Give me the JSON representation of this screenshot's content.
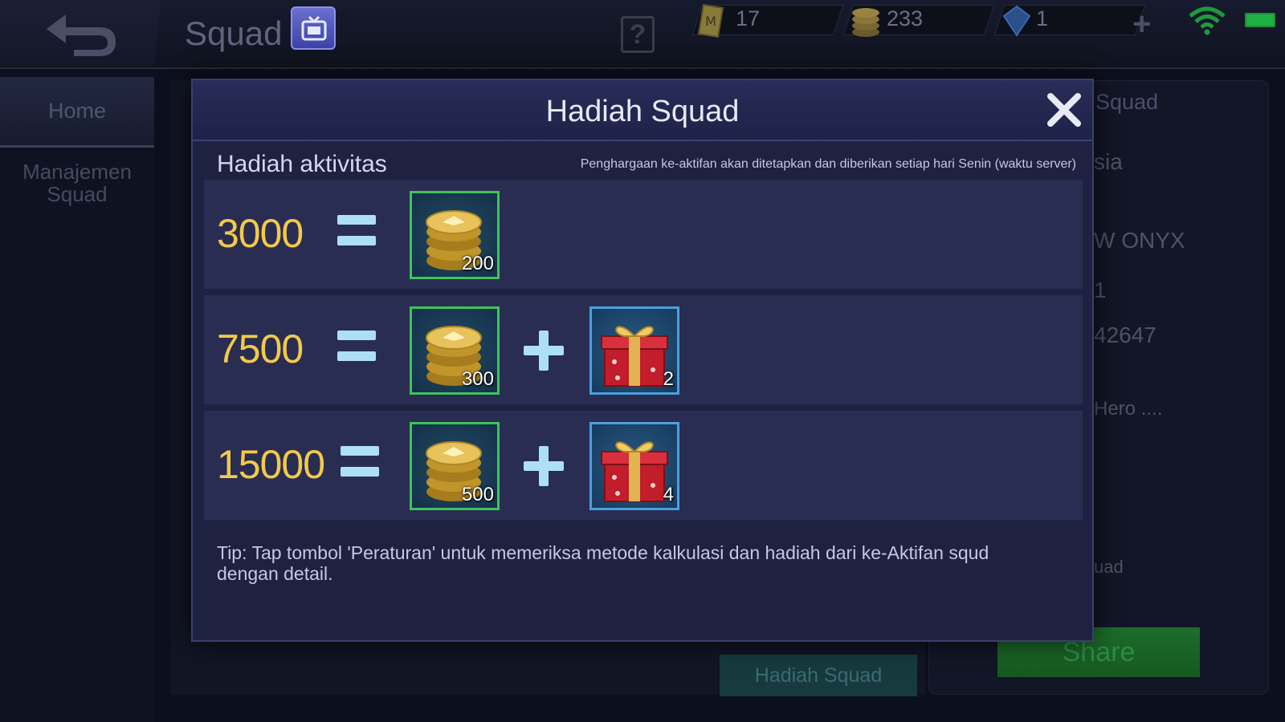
{
  "topbar": {
    "title": "Squad",
    "help_symbol": "?",
    "resources": [
      {
        "icon": "ticket-icon",
        "value": "17"
      },
      {
        "icon": "battle-point-icon",
        "value": "233"
      },
      {
        "icon": "diamond-icon",
        "value": "1"
      }
    ]
  },
  "sidebar": {
    "items": [
      {
        "label": "Home"
      },
      {
        "label": "Manajemen Squad"
      }
    ]
  },
  "background_panel": {
    "tab_label": "Squad",
    "lines": [
      "sia",
      "W ONYX",
      "1",
      "42647",
      "Hero ....",
      "uad"
    ],
    "share_label": "Share",
    "hadiah_button_label": "Hadiah Squad"
  },
  "modal": {
    "title": "Hadiah Squad",
    "section_title": "Hadiah aktivitas",
    "section_note": "Penghargaan ke-aktifan akan ditetapkan dan diberikan setiap hari Senin (waktu server)",
    "rows": [
      {
        "points": "3000",
        "items": [
          {
            "type": "battle-point-icon",
            "count": "200"
          }
        ]
      },
      {
        "points": "7500",
        "items": [
          {
            "type": "battle-point-icon",
            "count": "300"
          },
          {
            "type": "gift-box-icon",
            "count": "2"
          }
        ]
      },
      {
        "points": "15000",
        "items": [
          {
            "type": "battle-point-icon",
            "count": "500"
          },
          {
            "type": "gift-box-icon",
            "count": "4"
          }
        ]
      }
    ],
    "tip": "Tip: Tap tombol 'Peraturan' untuk memeriksa metode kalkulasi dan hadiah dari ke-Aktifan squd dengan detail."
  },
  "colors": {
    "points": "#f2c94a",
    "coin_border": "#3fc35a",
    "gift_border": "#4aa0dc",
    "modal_bg": "#1e2140"
  }
}
